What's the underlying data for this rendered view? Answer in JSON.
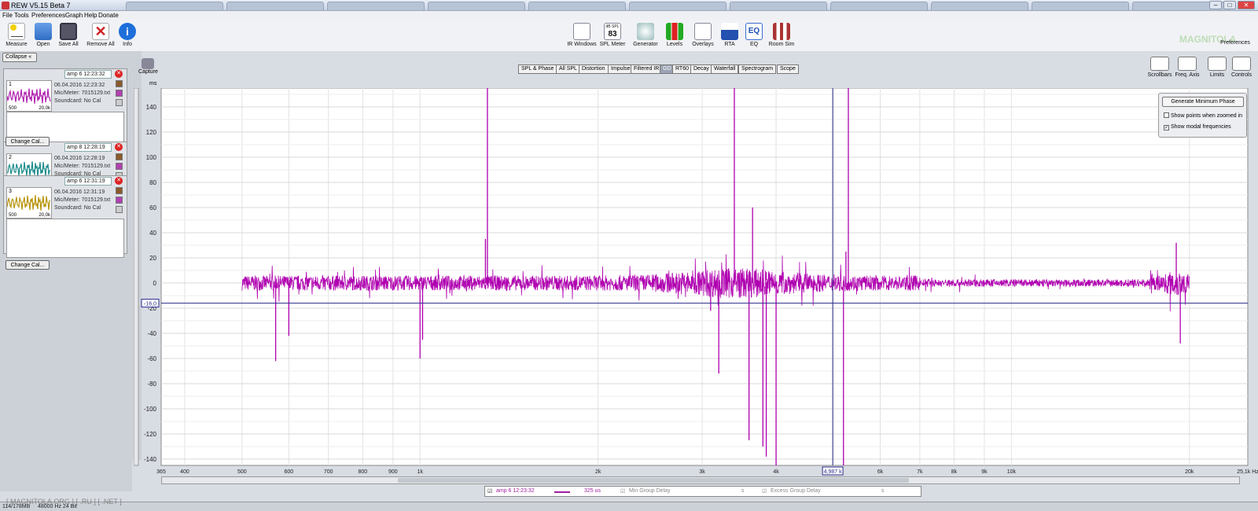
{
  "window": {
    "title": "REW V5.15 Beta 7",
    "tabs": [
      "",
      "",
      "",
      "",
      "",
      "",
      "",
      "",
      "",
      "",
      ""
    ]
  },
  "menu": [
    "File",
    "Tools",
    "Preferences",
    "Graph",
    "Help",
    "Donate"
  ],
  "toolbar_left": [
    {
      "label": "Measure",
      "icon": "measure-icon",
      "color": "#e6b800"
    },
    {
      "label": "Open",
      "icon": "folder-open-icon",
      "color": "#3a7bd5"
    },
    {
      "label": "Save All",
      "icon": "save-icon",
      "color": "#555"
    },
    {
      "label": "Remove All",
      "icon": "remove-all-icon",
      "color": "#cc2222"
    },
    {
      "label": "Info",
      "icon": "info-icon",
      "color": "#1e6fd9"
    }
  ],
  "toolbar_center": [
    {
      "label": "IR Windows",
      "icon": "ir-windows-icon"
    },
    {
      "label": "SPL Meter",
      "icon": "spl-meter-icon",
      "readout": "83",
      "unit": "dB SPL"
    },
    {
      "label": "Generator",
      "icon": "generator-icon"
    },
    {
      "label": "Levels",
      "icon": "levels-icon"
    },
    {
      "label": "Overlays",
      "icon": "overlays-icon"
    },
    {
      "label": "RTA",
      "icon": "rta-icon"
    },
    {
      "label": "EQ",
      "icon": "eq-icon"
    },
    {
      "label": "Room Sim",
      "icon": "room-sim-icon"
    }
  ],
  "preferences_label": "Preferences",
  "sidebar": {
    "collapse_label": "Collapse",
    "change_cal_label": "Change Cal...",
    "measurements": [
      {
        "index": "1",
        "name": "amp 6 12:23:32",
        "date": "06.04.2016 12:23:32",
        "mic": "Mic/Meter: 7015129.txt",
        "soundcard": "Soundcard: No Cal",
        "color": "#b020b0",
        "lo": "500",
        "hi": "20,0k"
      },
      {
        "index": "2",
        "name": "amp 8 12:28:19",
        "date": "06.04.2016 12:28:19",
        "mic": "Mic/Meter: 7015129.txt",
        "soundcard": "Soundcard: No Cal",
        "color": "#1a8a8a",
        "lo": "500",
        "hi": "20,0k"
      },
      {
        "index": "3",
        "name": "amp 6 12:31:19",
        "date": "06.04.2016 12:31:19",
        "mic": "Mic/Meter: 7015129.txt",
        "soundcard": "Soundcard: No Cal",
        "color": "#b8940e",
        "lo": "500",
        "hi": "20,0k"
      }
    ]
  },
  "capture": {
    "label": "Capture",
    "unit": "ms"
  },
  "graph_tabs": [
    "SPL & Phase",
    "All SPL",
    "Distortion",
    "Impulse",
    "Filtered IR",
    "GD",
    "RT60",
    "Decay",
    "Waterfall",
    "Spectrogram",
    "Scope"
  ],
  "graph_tab_active": "GD",
  "right_tools": [
    {
      "label": "Scrollbars",
      "icon": "scrollbars-icon"
    },
    {
      "label": "Freq. Axis",
      "icon": "freq-axis-icon"
    },
    {
      "label": "Limits",
      "icon": "limits-icon"
    },
    {
      "label": "Controls",
      "icon": "controls-icon"
    }
  ],
  "controls": {
    "button": "Generate Minimum Phase",
    "show_points": "Show points when zoomed in",
    "show_points_checked": false,
    "show_modal": "Show modal frequencies",
    "show_modal_checked": true
  },
  "chart_data": {
    "type": "line",
    "ylabel": "ms",
    "xscale": "log",
    "xlim": [
      365,
      25100
    ],
    "ylim": [
      -145,
      155
    ],
    "xticks": [
      365,
      400,
      500,
      600,
      700,
      800,
      900,
      1000,
      2000,
      3000,
      4000,
      5000,
      6000,
      7000,
      8000,
      9000,
      10000,
      20000,
      25100
    ],
    "xtick_labels": [
      "365",
      "400",
      "500",
      "600",
      "700",
      "800",
      "900",
      "1k",
      "2k",
      "3k",
      "4k",
      "5k",
      "6k",
      "7k",
      "8k",
      "9k",
      "10k",
      "20k",
      "25,1k Hz"
    ],
    "yticks": [
      -140,
      -120,
      -100,
      -80,
      -60,
      -40,
      -20,
      0,
      20,
      40,
      60,
      80,
      100,
      120,
      140
    ],
    "grid": true,
    "series": [
      {
        "color": "#b000b0",
        "x_range": [
          500,
          20000
        ],
        "baseline": 0,
        "spikes": [
          [
            570,
            -62
          ],
          [
            600,
            -42
          ],
          [
            1000,
            -60
          ],
          [
            1010,
            -45
          ],
          [
            1300,
            155
          ],
          [
            1290,
            35
          ],
          [
            3100,
            -22
          ],
          [
            3200,
            -72
          ],
          [
            3400,
            155
          ],
          [
            3600,
            -125
          ],
          [
            3650,
            60
          ],
          [
            3800,
            -130
          ],
          [
            3850,
            -138
          ],
          [
            4000,
            -145
          ],
          [
            5300,
            155
          ],
          [
            5200,
            -145
          ],
          [
            5250,
            25
          ],
          [
            19000,
            32
          ],
          [
            19300,
            -48
          ]
        ]
      }
    ],
    "cursor": {
      "x_label": "4,987 k",
      "y_label": "-16,0"
    }
  },
  "legend": {
    "name": "amp 6 12:23:32",
    "value": "325 us",
    "mgd": "Min Group Delay",
    "mgd_unit": "s",
    "egd": "Excess Group Delay",
    "egd_unit": "s"
  },
  "status": {
    "mem": "114/178MB",
    "rate": "48000 Hz 24 Bit",
    "watermark": "[ MAGNITOLA.ORG ] [ .RU ] [ .NET ]"
  },
  "logo": "MAGNITOLA"
}
